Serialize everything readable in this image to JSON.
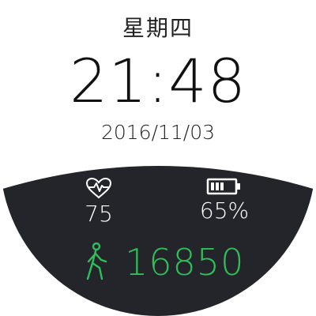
{
  "watchface": {
    "weekday": "星期四",
    "time": "21:48",
    "date": "2016/11/03"
  },
  "stats": {
    "heart_rate": "75",
    "battery": "65%",
    "battery_level": 0.65,
    "steps": "16850"
  },
  "colors": {
    "background": "#ffffff",
    "panel": "#23252a",
    "text_dark": "#111111",
    "text_light": "#ffffff",
    "accent_green": "#2fbf5a"
  },
  "icons": {
    "heart": "heart-pulse-icon",
    "battery": "battery-icon",
    "steps": "walking-person-icon"
  }
}
